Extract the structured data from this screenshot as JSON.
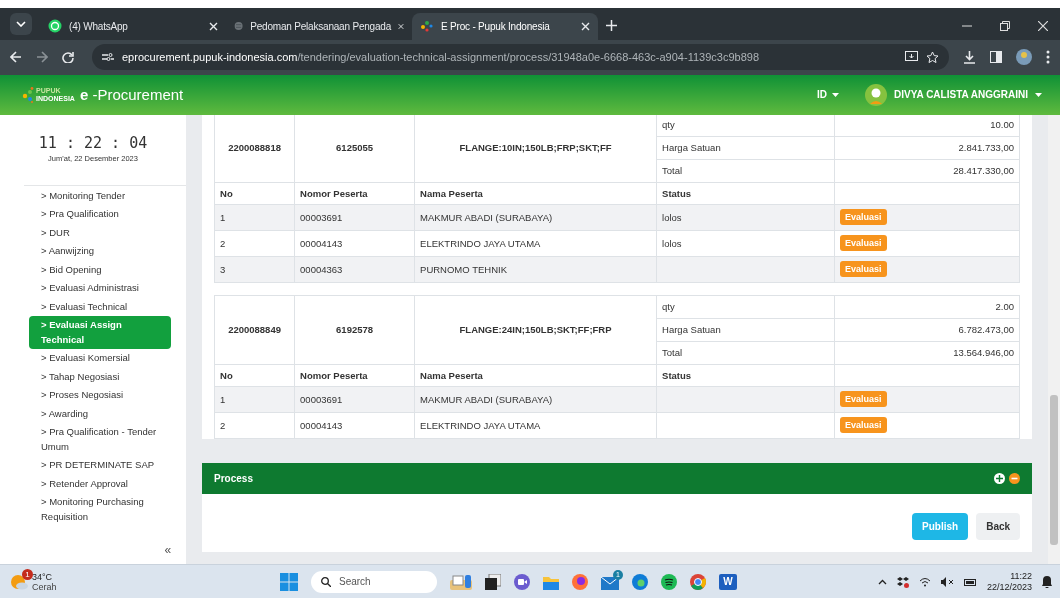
{
  "browser": {
    "tabs": [
      {
        "title": "(4) WhatsApp",
        "kind": "chat",
        "selected": false
      },
      {
        "title": "Pedoman Pelaksanaan Pengada",
        "kind": "globe",
        "selected": false
      },
      {
        "title": "E Proc - Pupuk Indonesia",
        "kind": "dots",
        "selected": true
      }
    ],
    "url_domain": "eprocurement.pupuk-indonesia.com",
    "url_path": "/tendering/evaluation-technical-assignment/process/31948a0e-6668-463c-a904-1139c3c9b898"
  },
  "header": {
    "logo_top": "PUPUK",
    "logo_bottom": "INDONESIA",
    "app_name": "**e** -Procurement",
    "language": "ID",
    "user": "DIVYA CALISTA ANGGRAINI"
  },
  "sidebar": {
    "time": "11 : 22 : 04",
    "date": "Jum'at, 22 Desember 2023",
    "items": [
      {
        "label": "> Monitoring Tender",
        "selected": false
      },
      {
        "label": "> Pra Qualification",
        "selected": false
      },
      {
        "label": "> DUR",
        "selected": false
      },
      {
        "label": "> Aanwijzing",
        "selected": false
      },
      {
        "label": "> Bid Opening",
        "selected": false
      },
      {
        "label": "> Evaluasi Administrasi",
        "selected": false
      },
      {
        "label": "> Evaluasi Technical",
        "selected": false
      },
      {
        "label": "> Evaluasi Assign Technical",
        "selected": true
      },
      {
        "label": "> Evaluasi Komersial",
        "selected": false
      },
      {
        "label": "> Tahap Negosiasi",
        "selected": false
      },
      {
        "label": "> Proses Negosiasi",
        "selected": false
      },
      {
        "label": "> Awarding",
        "selected": false
      },
      {
        "label": "> Pra Qualification - Tender Umum",
        "selected": false
      },
      {
        "label": "> PR DETERMINATE SAP",
        "selected": false
      },
      {
        "label": "> Retender Approval",
        "selected": false
      },
      {
        "label": "> Monitoring Purchasing Requisition",
        "selected": false
      }
    ],
    "collapse": "«"
  },
  "items": [
    {
      "pr_number": "2200088818",
      "material": "6125055",
      "description": "FLANGE:10IN;150LB;FRP;SKT;FF",
      "details": [
        {
          "label": "qty",
          "value": "10.00"
        },
        {
          "label": "Harga Satuan",
          "value": "2.841.733,00"
        },
        {
          "label": "Total",
          "value": "28.417.330,00"
        }
      ],
      "columns": [
        "No",
        "Nomor Peserta",
        "Nama Peserta",
        "Status"
      ],
      "participants": [
        {
          "no": "1",
          "nomor": "00003691",
          "nama": "MAKMUR ABADI (SURABAYA)",
          "status": "lolos",
          "action": "Evaluasi"
        },
        {
          "no": "2",
          "nomor": "00004143",
          "nama": "ELEKTRINDO JAYA UTAMA",
          "status": "lolos",
          "action": "Evaluasi"
        },
        {
          "no": "3",
          "nomor": "00004363",
          "nama": "PURNOMO TEHNIK",
          "action": "Evaluasi"
        }
      ]
    },
    {
      "pr_number": "2200088849",
      "material": "6192578",
      "description": "FLANGE:24IN;150LB;SKT;FF;FRP",
      "details": [
        {
          "label": "qty",
          "value": "2.00"
        },
        {
          "label": "Harga Satuan",
          "value": "6.782.473,00"
        },
        {
          "label": "Total",
          "value": "13.564.946,00"
        }
      ],
      "columns": [
        "No",
        "Nomor Peserta",
        "Nama Peserta",
        "Status"
      ],
      "participants": [
        {
          "no": "1",
          "nomor": "00003691",
          "nama": "MAKMUR ABADI (SURABAYA)",
          "action": "Evaluasi"
        },
        {
          "no": "2",
          "nomor": "00004143",
          "nama": "ELEKTRINDO JAYA UTAMA",
          "action": "Evaluasi"
        }
      ]
    }
  ],
  "process": {
    "title": "Process",
    "buttons": [
      {
        "label": "Publish",
        "kind": "primary"
      },
      {
        "label": "Back",
        "kind": "secondary"
      }
    ]
  },
  "taskbar": {
    "weather_badge": "1",
    "temperature": "34°C",
    "condition": "Cerah",
    "search_placeholder": "Search",
    "apps": [
      {
        "kind": "notes"
      },
      {
        "kind": "taskview"
      },
      {
        "kind": "camera"
      },
      {
        "kind": "folder"
      },
      {
        "kind": "fox"
      },
      {
        "kind": "mail",
        "badge": "1"
      },
      {
        "kind": "swirl"
      },
      {
        "kind": "music"
      },
      {
        "kind": "ring"
      },
      {
        "kind": "doc",
        "letter": "W"
      }
    ],
    "time": "11:22",
    "date": "22/12/2023"
  }
}
